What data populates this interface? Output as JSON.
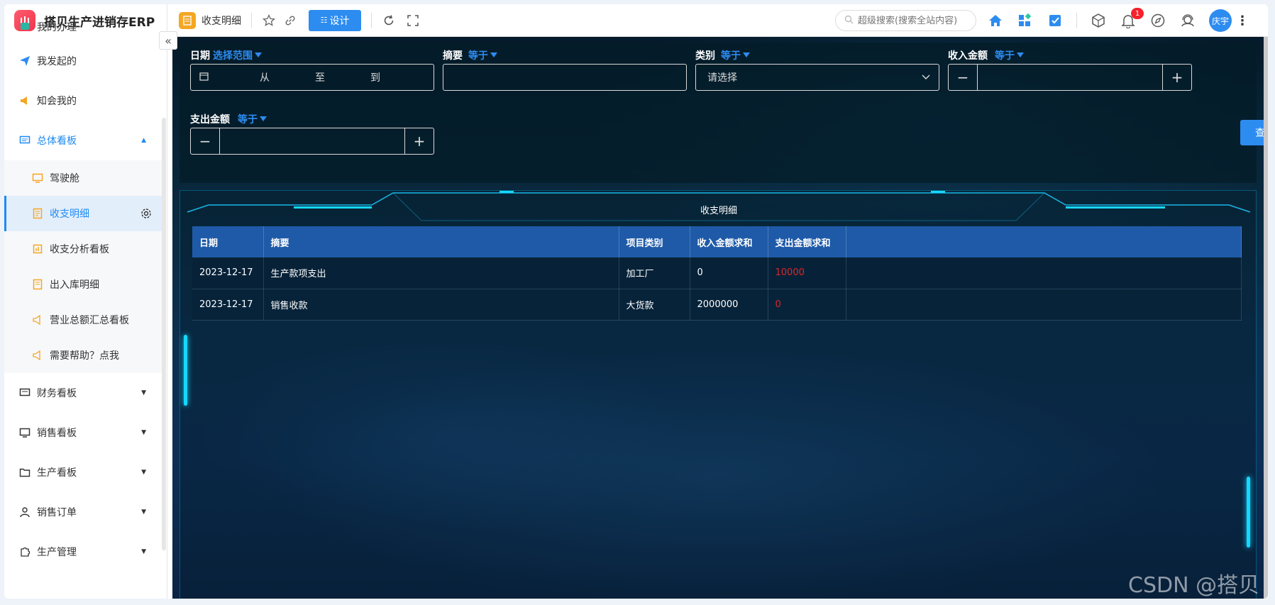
{
  "brand": {
    "name": "搭贝生产进销存ERP"
  },
  "sidebar": {
    "items": [
      {
        "label": "我的办理",
        "type": "item"
      },
      {
        "label": "我发起的",
        "type": "item"
      },
      {
        "label": "知会我的",
        "type": "item"
      },
      {
        "label": "总体看板",
        "type": "group-open"
      },
      {
        "label": "驾驶舱",
        "type": "sub"
      },
      {
        "label": "收支明细",
        "type": "sub-active"
      },
      {
        "label": "收支分析看板",
        "type": "sub"
      },
      {
        "label": "出入库明细",
        "type": "sub"
      },
      {
        "label": "营业总额汇总看板",
        "type": "sub"
      },
      {
        "label": "需要帮助？点我",
        "type": "sub"
      },
      {
        "label": "财务看板",
        "type": "group"
      },
      {
        "label": "销售看板",
        "type": "group"
      },
      {
        "label": "生产看板",
        "type": "group"
      },
      {
        "label": "销售订单",
        "type": "group"
      },
      {
        "label": "生产管理",
        "type": "group"
      }
    ]
  },
  "topbar": {
    "page_title": "收支明细",
    "design_label": "设计",
    "search_placeholder": "超级搜索(搜索全站内容)",
    "notification_count": "1",
    "user_name": "庆宇"
  },
  "filters": {
    "date": {
      "label": "日期",
      "op": "选择范围",
      "from": "从",
      "to": "至",
      "end": "到"
    },
    "summary": {
      "label": "摘要",
      "op": "等于"
    },
    "category": {
      "label": "类别",
      "op": "等于",
      "placeholder": "请选择"
    },
    "income": {
      "label": "收入金额",
      "op": "等于"
    },
    "expense": {
      "label": "支出金额",
      "op": "等于"
    },
    "query_label": "查询"
  },
  "table": {
    "title": "收支明细",
    "headers": [
      "日期",
      "摘要",
      "项目类别",
      "收入金额求和",
      "支出金额求和",
      ""
    ],
    "rows": [
      [
        "2023-12-17",
        "生产款项支出",
        "加工厂",
        "0",
        "10000",
        ""
      ],
      [
        "2023-12-17",
        "销售收款",
        "大货款",
        "2000000",
        "0",
        ""
      ]
    ]
  },
  "watermark": "CSDN @搭贝",
  "colors": {
    "accent": "#2d8cf0",
    "negative": "#e0242a",
    "header_bg": "#1e5aa8"
  }
}
